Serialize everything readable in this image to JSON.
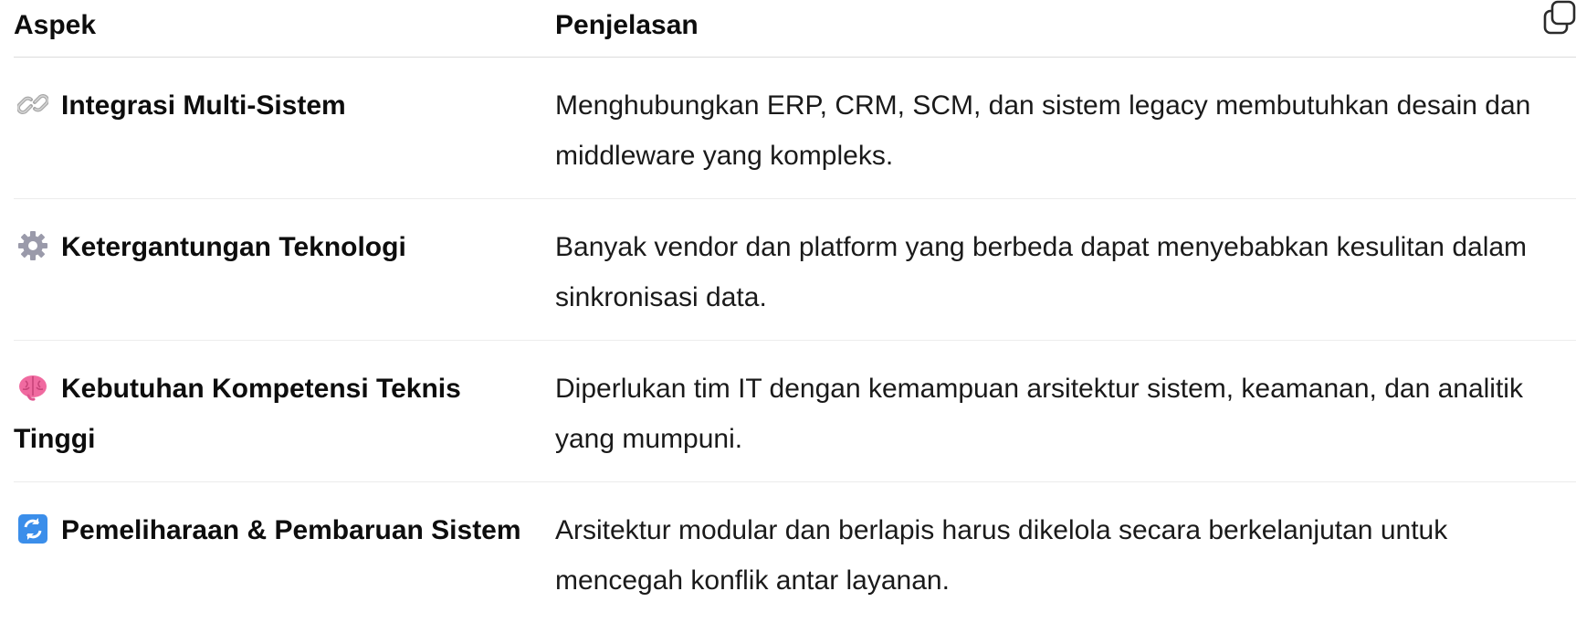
{
  "table": {
    "headers": [
      "Aspek",
      "Penjelasan"
    ],
    "rows": [
      {
        "icon": "link-icon",
        "aspect": "Integrasi Multi-Sistem",
        "explanation": "Menghubungkan ERP, CRM, SCM, dan sistem legacy membutuhkan desain dan middleware yang kompleks."
      },
      {
        "icon": "gear-icon",
        "aspect": "Ketergantungan Teknologi",
        "explanation": "Banyak vendor dan platform yang berbeda dapat menyebabkan kesulitan dalam sinkronisasi data."
      },
      {
        "icon": "brain-icon",
        "aspect": "Kebutuhan Kompetensi Teknis Tinggi",
        "explanation": "Diperlukan tim IT dengan kemampuan arsitektur sistem, keamanan, dan analitik yang mumpuni."
      },
      {
        "icon": "refresh-icon",
        "aspect": "Pemeliharaan & Pembaruan Sistem",
        "explanation": "Arsitektur modular dan berlapis harus dikelola secara berkelanjutan untuk mencegah konflik antar layanan."
      }
    ]
  },
  "toolbar": {
    "copy_icon": "copy-icon"
  }
}
